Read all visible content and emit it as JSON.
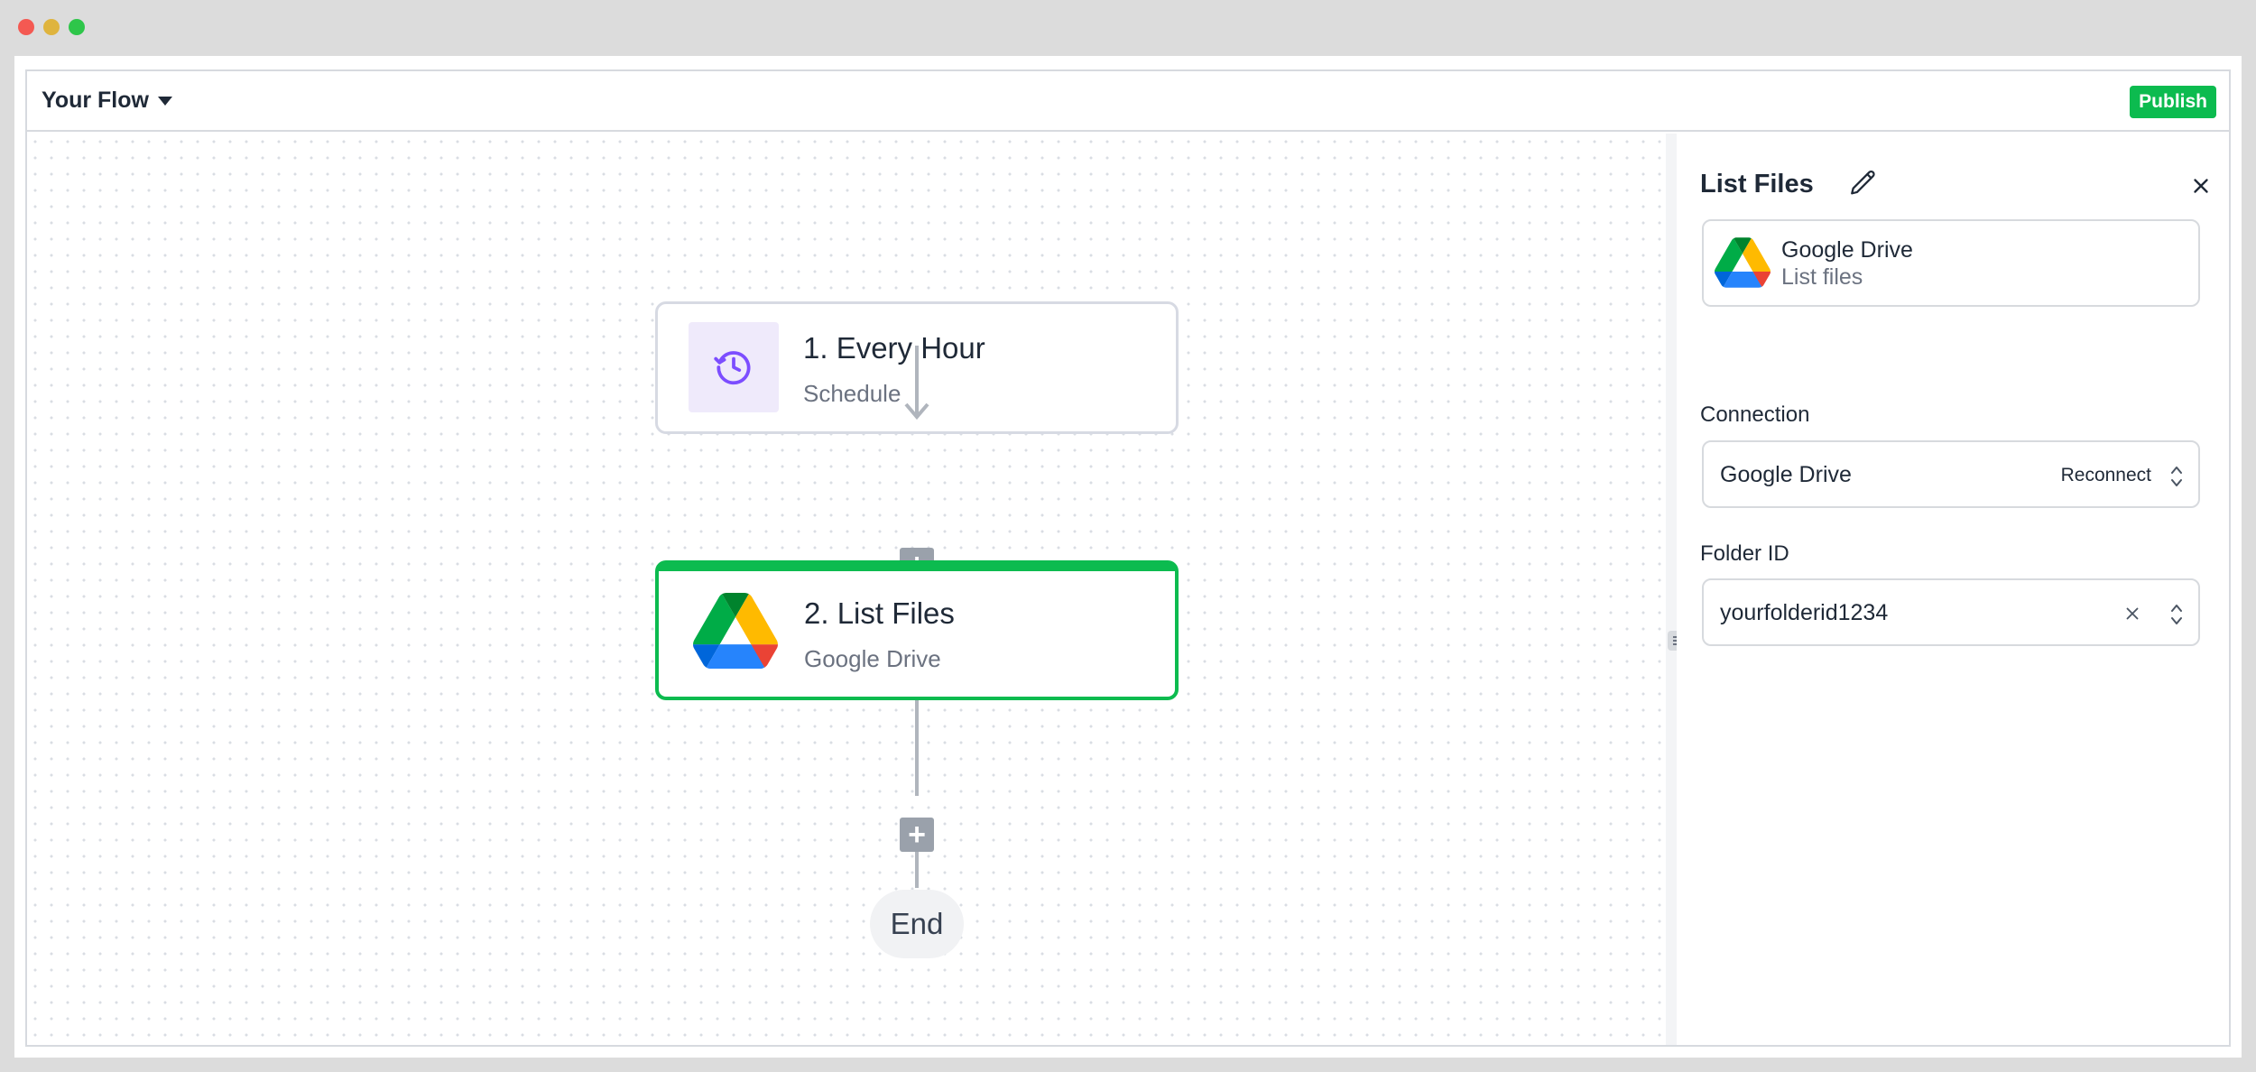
{
  "window": {
    "controls": [
      "close",
      "minimize",
      "maximize"
    ]
  },
  "topbar": {
    "flow_name": "Your Flow",
    "publish_label": "Publish"
  },
  "canvas": {
    "nodes": [
      {
        "title": "1. Every Hour",
        "subtitle": "Schedule",
        "icon": "clock-schedule-icon"
      },
      {
        "title": "2. List Files",
        "subtitle": "Google Drive",
        "icon": "google-drive-icon",
        "selected": true
      }
    ],
    "end_label": "End",
    "zoom_controls": [
      "refresh-icon",
      "zoom-in-icon",
      "zoom-out-icon",
      "fit-view-icon"
    ]
  },
  "panel": {
    "title": "List Files",
    "app": {
      "name": "Google Drive",
      "action": "List files"
    },
    "connection": {
      "label": "Connection",
      "value": "Google Drive",
      "reconnect_label": "Reconnect"
    },
    "folder": {
      "label": "Folder ID",
      "value": "yourfolderid1234"
    }
  },
  "colors": {
    "accent": "#0cbb4f",
    "schedule_icon": "#7c4dff",
    "connector": "#b0b5bd"
  }
}
